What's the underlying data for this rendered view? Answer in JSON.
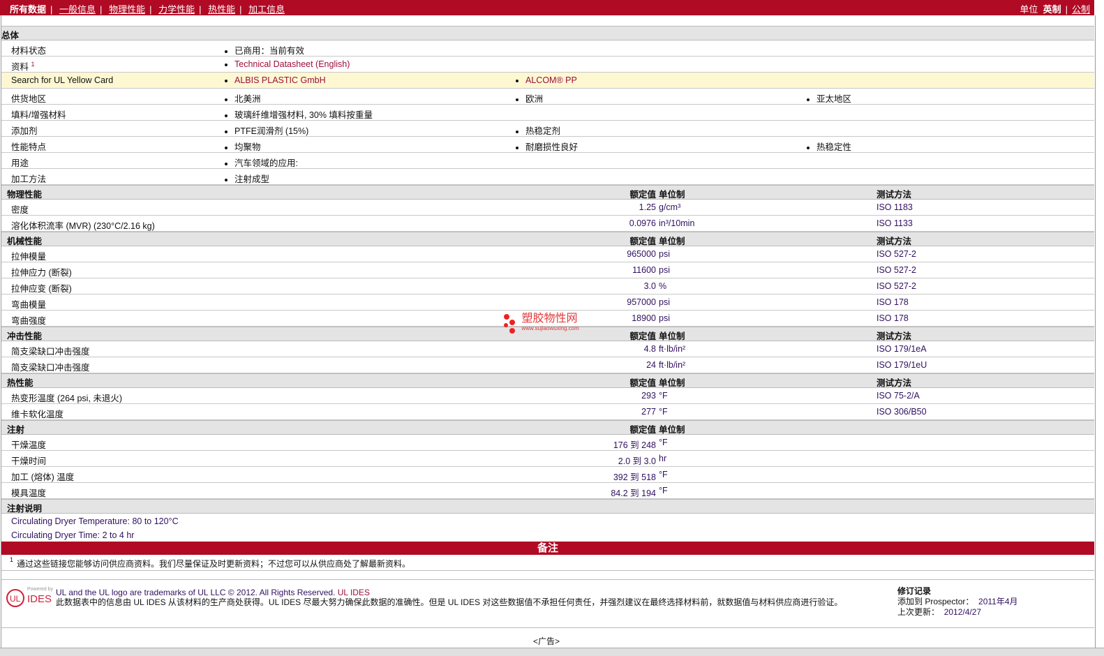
{
  "nav": {
    "items": [
      "所有数据",
      "一般信息",
      "物理性能",
      "力学性能",
      "热性能",
      "加工信息"
    ],
    "units_label": "单位",
    "unit_english": "英制",
    "unit_metric": "公制"
  },
  "general": {
    "title": "总体",
    "rows": [
      {
        "label": "材料状态",
        "values": [
          "已商用：当前有效"
        ]
      },
      {
        "label": "资料",
        "sup": "1",
        "values": [
          "Technical Datasheet (English)"
        ],
        "link": true
      },
      {
        "label": "Search for UL Yellow Card",
        "values": [
          "ALBIS PLASTIC GmbH",
          "ALCOM® PP"
        ],
        "link": true,
        "yellow": true
      },
      {
        "label": "供货地区",
        "values": [
          "北美洲",
          "欧洲",
          "亚太地区"
        ]
      },
      {
        "label": "填料/增强材料",
        "values": [
          "玻璃纤维增强材料, 30% 填料按重量"
        ]
      },
      {
        "label": "添加剂",
        "values": [
          "PTFE润滑剂 (15%)",
          "热稳定剂"
        ]
      },
      {
        "label": "性能特点",
        "values": [
          "均聚物",
          "耐磨损性良好",
          "热稳定性"
        ]
      },
      {
        "label": "用途",
        "values": [
          "汽车领域的应用:"
        ]
      },
      {
        "label": "加工方法",
        "values": [
          "注射成型"
        ]
      }
    ]
  },
  "headers": {
    "value": "额定值",
    "unit": "单位制",
    "method": "测试方法"
  },
  "sections": [
    {
      "title": "物理性能",
      "method": true,
      "rows": [
        {
          "label": "密度",
          "value": "1.25",
          "unit": "g/cm³",
          "method": "ISO 1183"
        },
        {
          "label": "溶化体积流率 (MVR)  (230°C/2.16 kg)",
          "value": "0.0976",
          "unit": "in³/10min",
          "method": "ISO 1133"
        }
      ]
    },
    {
      "title": "机械性能",
      "method": true,
      "rows": [
        {
          "label": "拉伸模量",
          "value": "965000",
          "unit": "psi",
          "method": "ISO 527-2"
        },
        {
          "label": "拉伸应力 (断裂)",
          "value": "11600",
          "unit": "psi",
          "method": "ISO 527-2"
        },
        {
          "label": "拉伸应变 (断裂)",
          "value": "3.0",
          "unit": "%",
          "method": "ISO 527-2"
        },
        {
          "label": "弯曲模量",
          "value": "957000",
          "unit": "psi",
          "method": "ISO 178"
        },
        {
          "label": "弯曲强度",
          "value": "18900",
          "unit": "psi",
          "method": "ISO 178"
        }
      ]
    },
    {
      "title": "冲击性能",
      "method": true,
      "rows": [
        {
          "label": "简支梁缺口冲击强度",
          "value": "4.8",
          "unit": "ft·lb/in²",
          "method": "ISO 179/1eA"
        },
        {
          "label": "简支梁缺口冲击强度",
          "value": "24",
          "unit": "ft·lb/in²",
          "method": "ISO 179/1eU"
        }
      ]
    },
    {
      "title": "热性能",
      "method": true,
      "rows": [
        {
          "label": "热变形温度 (264 psi, 未退火)",
          "value": "293",
          "unit": "°F",
          "method": "ISO 75-2/A"
        },
        {
          "label": "维卡软化温度",
          "value": "277",
          "unit": "°F",
          "method": "ISO 306/B50"
        }
      ]
    },
    {
      "title": "注射",
      "method": false,
      "rows": [
        {
          "label": "干燥温度",
          "value": "176 到  248",
          "unit": "°F"
        },
        {
          "label": "干燥时间",
          "value": "2.0 到  3.0",
          "unit": "hr"
        },
        {
          "label": "加工 (熔体) 温度",
          "value": "392 到  518",
          "unit": "°F"
        },
        {
          "label": "模具温度",
          "value": "84.2 到  194",
          "unit": "°F"
        }
      ]
    }
  ],
  "injection_notes": {
    "title": "注射说明",
    "lines": [
      "Circulating Dryer Temperature: 80 to 120°C",
      "Circulating Dryer Time: 2 to 4 hr"
    ]
  },
  "remarks": {
    "title": "备注",
    "footnote_num": "1",
    "footnote": "通过这些链接您能够访问供应商资料。我们尽量保证及时更新资料；不过您可以从供应商处了解最新资料。"
  },
  "footer": {
    "logo_text": "IDES",
    "powered_by": "Powered by",
    "line1": "UL and the UL logo are trademarks of UL LLC © 2012. All Rights Reserved.",
    "line1_link": "UL IDES",
    "line2": "此数据表中的信息由 UL IDES 从该材料的生产商处获得。UL IDES 尽最大努力确保此数据的准确性。但是 UL IDES 对这些数据值不承担任何责任，并强烈建议在最终选择材料前，就数据值与材料供应商进行验证。",
    "revision_title": "修订记录",
    "added_label": "添加到 Prospector：",
    "added_value": "2011年4月",
    "updated_label": "上次更新：",
    "updated_value": "2012/4/27"
  },
  "watermark": {
    "name": "塑胶物性网",
    "url": "www.sujiaowuxing.com"
  },
  "ad": "<广告>"
}
